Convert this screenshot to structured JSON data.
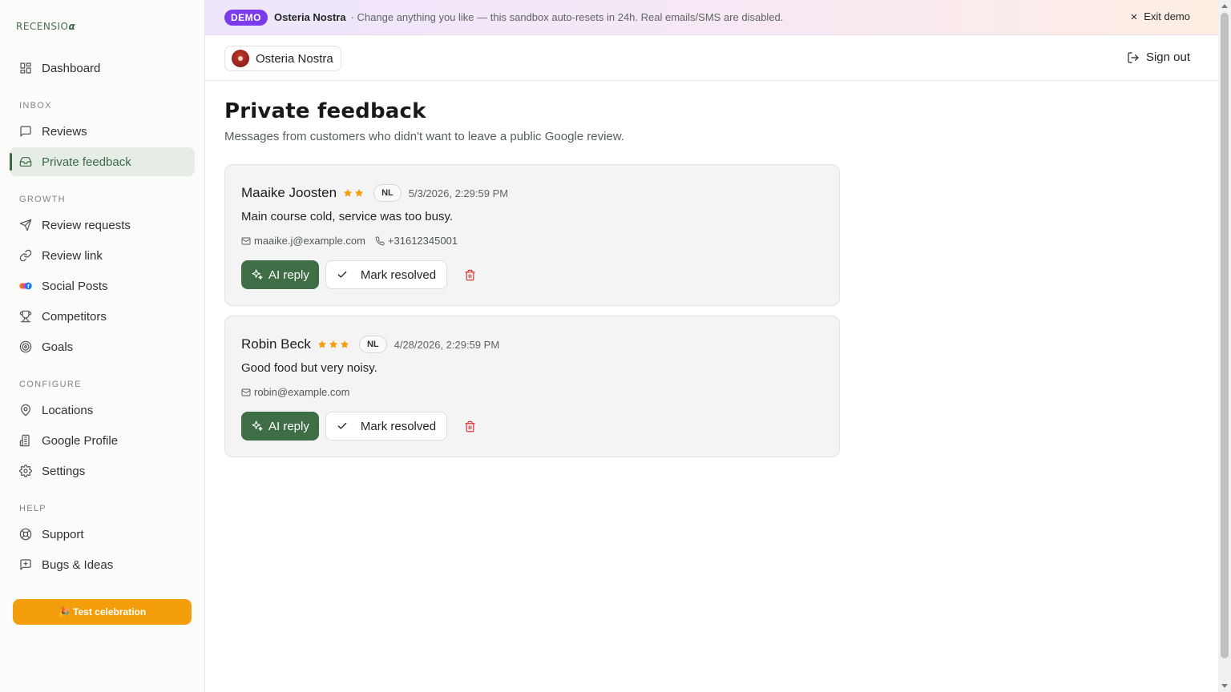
{
  "brand": {
    "logo_text": "RECENSIO",
    "logo_mark": "α"
  },
  "sidebar": {
    "dashboard": "Dashboard",
    "sections": {
      "inbox": "INBOX",
      "growth": "GROWTH",
      "configure": "CONFIGURE",
      "help": "HELP"
    },
    "inbox": [
      "Reviews",
      "Private feedback"
    ],
    "growth": [
      "Review requests",
      "Review link",
      "Social Posts",
      "Competitors",
      "Goals"
    ],
    "configure": [
      "Locations",
      "Google Profile",
      "Settings"
    ],
    "help": [
      "Support",
      "Bugs & Ideas"
    ],
    "celebration_button": "🎉 Test celebration"
  },
  "banner": {
    "badge": "DEMO",
    "business": "Osteria Nostra",
    "message": "· Change anything you like — this sandbox auto-resets in 24h. Real emails/SMS are disabled.",
    "exit_label": "Exit demo"
  },
  "topbar": {
    "location": "Osteria Nostra",
    "signout_label": "Sign out"
  },
  "page": {
    "title": "Private feedback",
    "subtitle": "Messages from customers who didn't want to leave a public Google review."
  },
  "feedback": [
    {
      "name": "Maaike Joosten",
      "rating": 2,
      "lang": "NL",
      "timestamp": "5/3/2026, 2:29:59 PM",
      "message": "Main course cold, service was too busy.",
      "email": "maaike.j@example.com",
      "phone": "+31612345001"
    },
    {
      "name": "Robin Beck",
      "rating": 3,
      "lang": "NL",
      "timestamp": "4/28/2026, 2:29:59 PM",
      "message": "Good food but very noisy.",
      "email": "robin@example.com"
    }
  ],
  "actions": {
    "ai_reply": "AI reply",
    "mark_resolved": "Mark resolved"
  },
  "colors": {
    "accent": "#3f6d46",
    "demo_badge": "#7c3aed",
    "star": "#f59e0b",
    "celebrate": "#f59e0b",
    "danger": "#dc2626"
  }
}
